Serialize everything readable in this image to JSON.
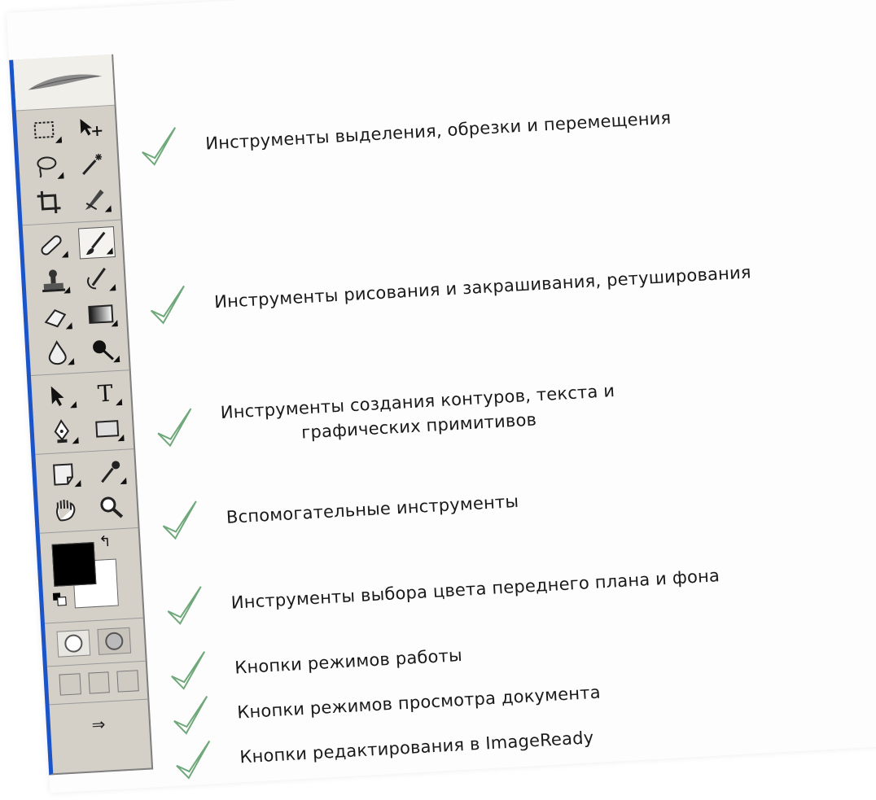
{
  "toolbox": {
    "groups": [
      {
        "tools": [
          [
            "marquee-icon",
            "move-icon"
          ],
          [
            "lasso-icon",
            "magic-wand-icon"
          ],
          [
            "crop-icon",
            "slice-icon"
          ]
        ]
      },
      {
        "tools": [
          [
            "healing-brush-icon",
            "brush-icon"
          ],
          [
            "clone-stamp-icon",
            "history-brush-icon"
          ],
          [
            "eraser-icon",
            "gradient-icon"
          ],
          [
            "blur-icon",
            "dodge-icon"
          ]
        ]
      },
      {
        "tools": [
          [
            "path-selection-icon",
            "type-icon"
          ],
          [
            "pen-icon",
            "rectangle-shape-icon"
          ]
        ]
      },
      {
        "tools": [
          [
            "notes-icon",
            "eyedropper-icon"
          ],
          [
            "hand-icon",
            "zoom-icon"
          ]
        ]
      }
    ],
    "colors": {
      "foreground": "#000000",
      "background": "#ffffff"
    },
    "type_glyph": "T",
    "swap_glyph": "↰",
    "imageready_glyph": "⇒"
  },
  "captions": [
    {
      "text": "Инструменты выделения, обрезки и перемещения"
    },
    {
      "text": "Инструменты рисования и закрашивания, ретуширования"
    },
    {
      "text": "Инструменты создания контуров, текста и",
      "text2": "графических примитивов"
    },
    {
      "text": "Вспомогательные инструменты"
    },
    {
      "text": "Инструменты выбора цвета переднего плана и фона"
    },
    {
      "text": "Кнопки режимов работы"
    },
    {
      "text": "Кнопки режимов просмотра документа"
    },
    {
      "text": "Кнопки редактирования в ImageReady"
    }
  ],
  "accent": {
    "check": "#6fa87a",
    "toolbox_border": "#1b54c8"
  }
}
